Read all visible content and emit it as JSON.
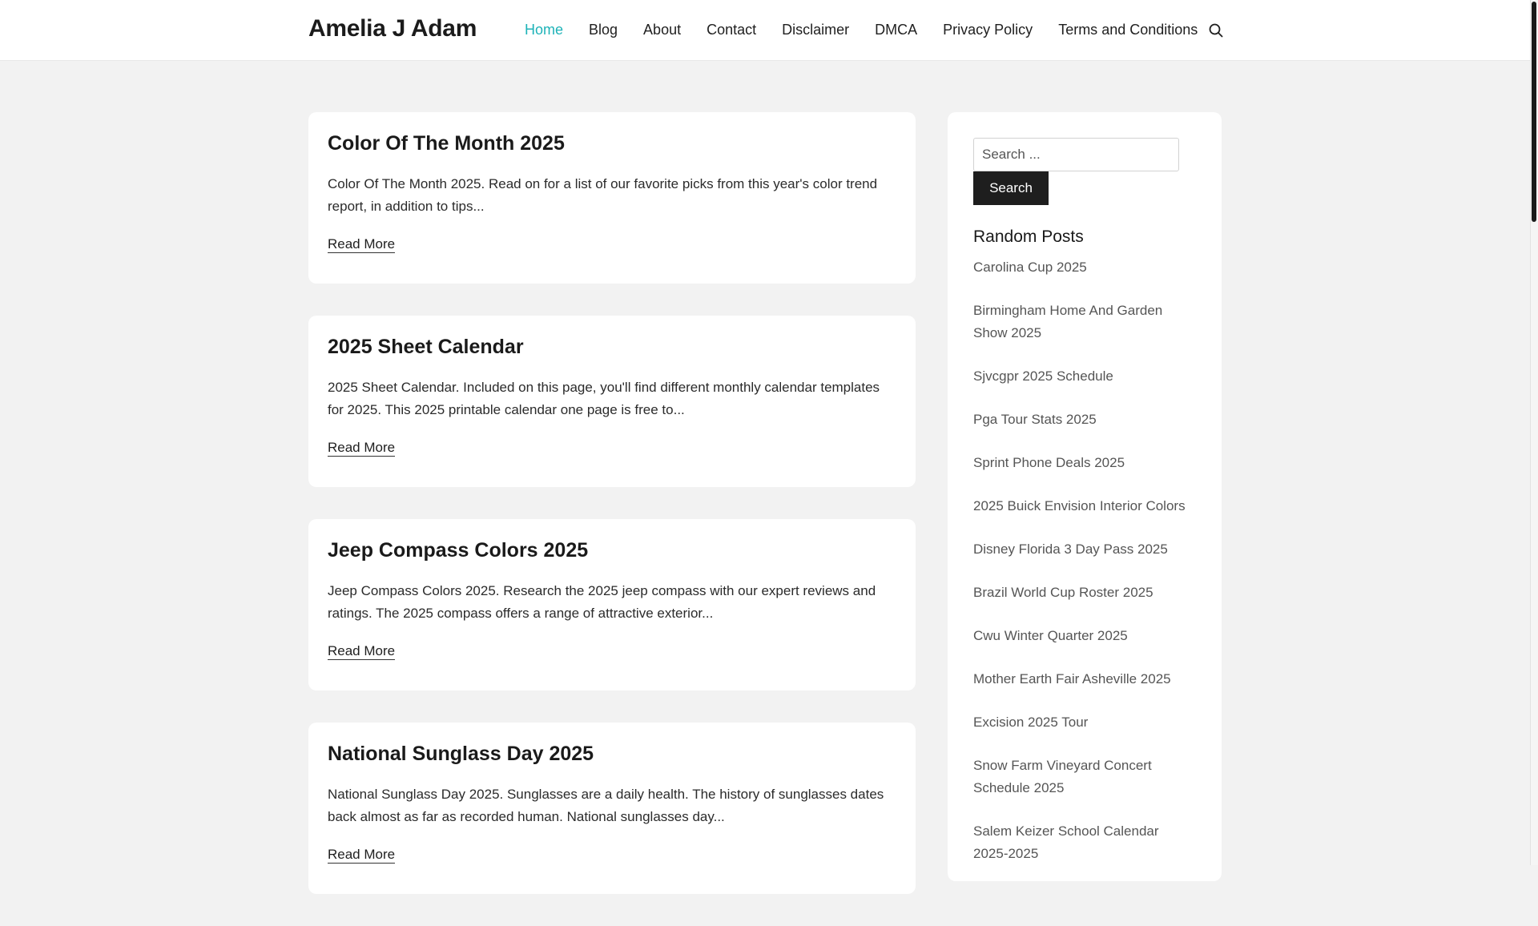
{
  "site": {
    "title": "Amelia J Adam"
  },
  "nav": {
    "items": [
      {
        "label": "Home",
        "active": true
      },
      {
        "label": "Blog"
      },
      {
        "label": "About"
      },
      {
        "label": "Contact"
      },
      {
        "label": "Disclaimer"
      },
      {
        "label": "DMCA"
      },
      {
        "label": "Privacy Policy"
      },
      {
        "label": "Terms and Conditions"
      }
    ],
    "search_icon": "search-icon"
  },
  "colors": {
    "accent": "#1eb3b8",
    "background": "#f2f2f2",
    "card": "#ffffff",
    "button": "#1e1e1e"
  },
  "posts": [
    {
      "title": "Color Of The Month 2025",
      "excerpt": "Color Of The Month 2025. Read on for a list of our favorite picks from this year's color trend report, in addition to tips...",
      "read_more": "Read More"
    },
    {
      "title": "2025 Sheet Calendar",
      "excerpt": "2025 Sheet Calendar. Included on this page, you'll find different monthly calendar templates for 2025. This 2025 printable calendar one page is free to...",
      "read_more": "Read More"
    },
    {
      "title": "Jeep Compass Colors 2025",
      "excerpt": "Jeep Compass Colors 2025. Research the 2025 jeep compass with our expert reviews and ratings. The 2025 compass offers a range of attractive exterior...",
      "read_more": "Read More"
    },
    {
      "title": "National Sunglass Day 2025",
      "excerpt": "National Sunglass Day 2025. Sunglasses are a daily health. The history of sunglasses dates back almost as far as recorded human. National sunglasses day...",
      "read_more": "Read More"
    }
  ],
  "sidebar": {
    "search": {
      "placeholder": "Search ...",
      "button_label": "Search"
    },
    "random_posts": {
      "title": "Random Posts",
      "items": [
        "Carolina Cup 2025",
        "Birmingham Home And Garden Show 2025",
        "Sjvcgpr 2025 Schedule",
        "Pga Tour Stats 2025",
        "Sprint Phone Deals 2025",
        "2025 Buick Envision Interior Colors",
        "Disney Florida 3 Day Pass 2025",
        "Brazil World Cup Roster 2025",
        "Cwu Winter Quarter 2025",
        "Mother Earth Fair Asheville 2025",
        "Excision 2025 Tour",
        "Snow Farm Vineyard Concert Schedule 2025",
        "Salem Keizer School Calendar 2025-2025"
      ]
    }
  }
}
